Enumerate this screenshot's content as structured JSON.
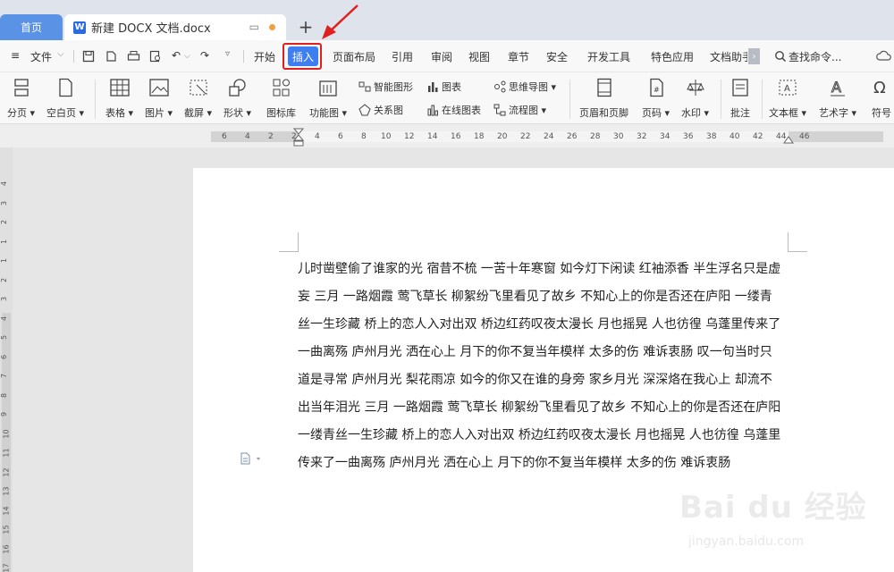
{
  "tabs": {
    "home_label": "首页",
    "doc_label": "新建 DOCX 文档.docx",
    "add_label": "+"
  },
  "menu": {
    "file_label": "文件",
    "items": [
      "开始",
      "插入",
      "页面布局",
      "引用",
      "审阅",
      "视图",
      "章节",
      "安全",
      "开发工具",
      "特色应用",
      "文档助手"
    ],
    "search_label": "查找命令...",
    "active_tab": "插入"
  },
  "toolbar": {
    "page_break": "分页",
    "blank_page": "空白页",
    "table": "表格",
    "picture": "图片",
    "screenshot": "截屏",
    "shapes": "形状",
    "icon_library": "图标库",
    "function_chart": "功能图",
    "smart_graphic": "智能图形",
    "chart": "图表",
    "relation_chart": "关系图",
    "online_chart": "在线图表",
    "mind_map": "思维导图",
    "flowchart": "流程图",
    "header_footer": "页眉和页脚",
    "page_number": "页码",
    "watermark": "水印",
    "comment": "批注",
    "textbox": "文本框",
    "art_text": "艺术字",
    "symbol": "符号"
  },
  "ruler": {
    "horizontal": [
      "6",
      "4",
      "2",
      "2",
      "4",
      "6",
      "8",
      "10",
      "12",
      "14",
      "16",
      "18",
      "20",
      "22",
      "24",
      "26",
      "28",
      "30",
      "32",
      "34",
      "36",
      "38",
      "40",
      "42",
      "44",
      "46"
    ],
    "vertical": [
      "4",
      "3",
      "2",
      "1",
      "1",
      "2",
      "3",
      "4",
      "5",
      "6",
      "7",
      "8",
      "9",
      "10",
      "11",
      "12",
      "13",
      "14",
      "15",
      "16",
      "17"
    ]
  },
  "document": {
    "lines": [
      "儿时凿壁偷了谁家的光 宿昔不梳 一苦十年寒窗 如今灯下闲读 红袖添香 半生浮名只是虚",
      "妄 三月 一路烟霞 莺飞草长 柳絮纷飞里看见了故乡 不知心上的你是否还在庐阳 一缕青",
      "丝一生珍藏 桥上的恋人入对出双 桥边红药叹夜太漫长 月也摇晃 人也彷徨 乌蓬里传来了",
      "一曲离殇 庐州月光 洒在心上 月下的你不复当年模样 太多的伤 难诉衷肠 叹一句当时只",
      "道是寻常 庐州月光 梨花雨凉 如今的你又在谁的身旁 家乡月光 深深烙在我心上 却流不",
      "出当年泪光 三月 一路烟霞 莺飞草长 柳絮纷飞里看见了故乡 不知心上的你是否还在庐阳",
      "一缕青丝一生珍藏 桥上的恋人入对出双 桥边红药叹夜太漫长 月也摇晃 人也彷徨 乌蓬里",
      "传来了一曲离殇 庐州月光 洒在心上 月下的你不复当年模样 太多的伤 难诉衷肠"
    ]
  },
  "watermark": {
    "brand": "Bai du 经验",
    "url": "jingyan.baidu.com"
  },
  "colors": {
    "accent": "#3f7ef0",
    "highlight_frame": "#e02020",
    "home_tab": "#5a92e6"
  }
}
